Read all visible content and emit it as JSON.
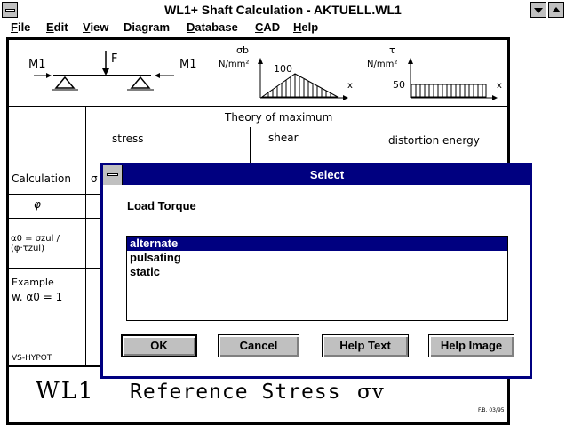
{
  "window": {
    "title": "WL1+    Shaft Calculation  - AKTUELL.WL1"
  },
  "menu": [
    {
      "key": "F",
      "rest": "ile"
    },
    {
      "key": "E",
      "rest": "dit"
    },
    {
      "key": "V",
      "rest": "iew"
    },
    {
      "key": "",
      "rest": "Diagram"
    },
    {
      "key": "D",
      "rest": "atabase"
    },
    {
      "key": "C",
      "rest": "AD"
    },
    {
      "key": "H",
      "rest": "elp"
    }
  ],
  "sheet": {
    "m1_left": "M1",
    "force": "F",
    "m1_right": "M1",
    "sigma_b": "σb",
    "unit1": "N/mm²",
    "val100": "100",
    "x1": "x",
    "tau": "τ",
    "unit2": "N/mm²",
    "val50": "50",
    "x2": "x",
    "theory": "Theory of maximum",
    "col_stress": "stress",
    "col_shear": "shear",
    "col_distortion": "distortion energy",
    "row_calculation": "Calculation",
    "row_sigma_partial": "σ",
    "row_phi": "φ",
    "row_alpha": "α0 = σzul / (φ·τzul)",
    "row_example": "Example",
    "row_example_value": "w.  α0 =  1",
    "vs_hypot": "VS-HYPOT",
    "wl1": "WL1",
    "reference_stress": "Reference Stress",
    "sigma_v": "σv",
    "footer_code": "F.B. 03/95"
  },
  "dialog": {
    "title": "Select",
    "prompt": "Load Torque",
    "options": [
      "alternate",
      "pulsating",
      "static"
    ],
    "selected_index": 0,
    "buttons": {
      "ok": "OK",
      "cancel": "Cancel",
      "help_text": "Help Text",
      "help_image": "Help Image"
    }
  },
  "colors": {
    "dialog_accent": "#000080",
    "button_face": "#c0c0c0"
  }
}
